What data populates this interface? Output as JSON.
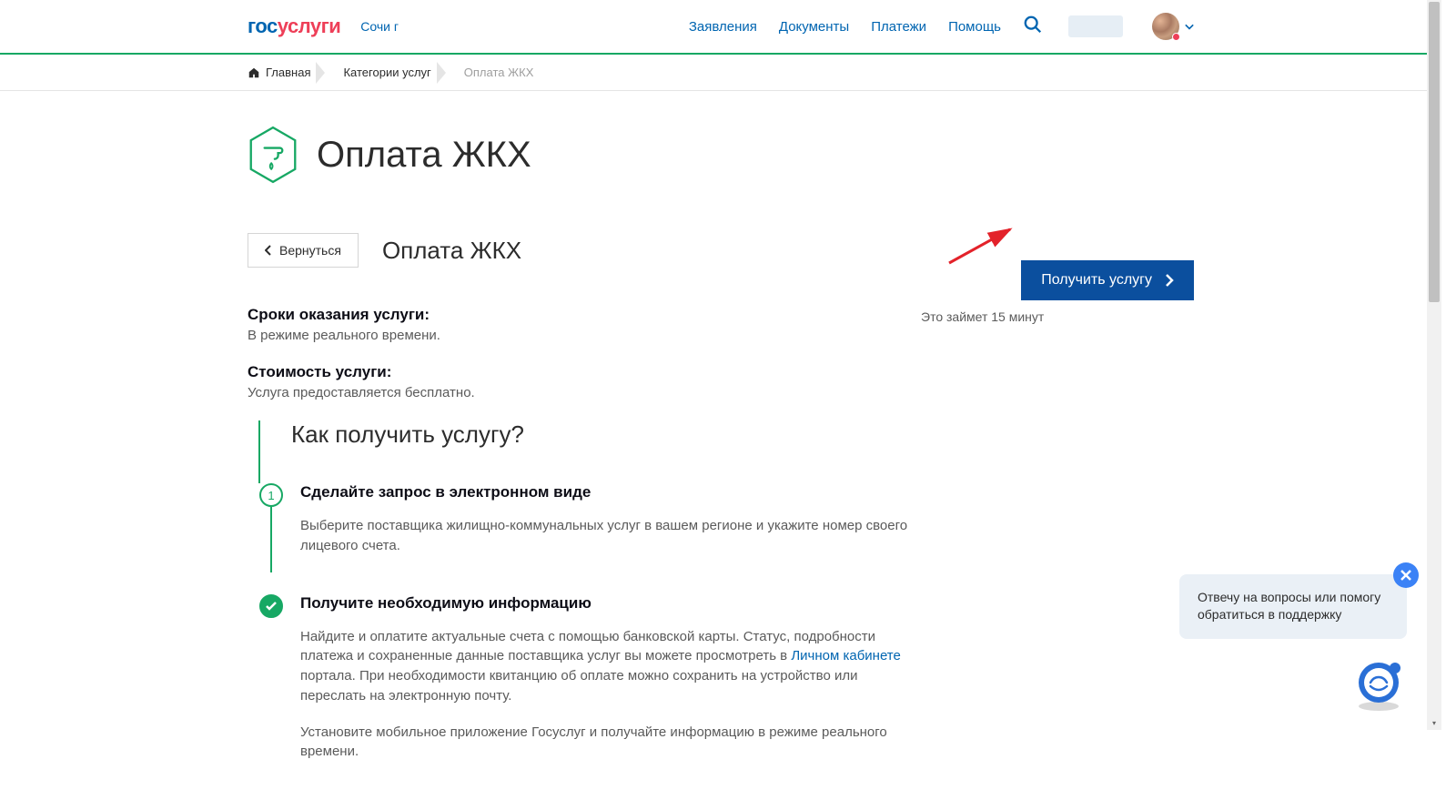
{
  "header": {
    "logo_gos": "гос",
    "logo_uslugi": "услуги",
    "region": "Сочи г",
    "nav": {
      "applications": "Заявления",
      "documents": "Документы",
      "payments": "Платежи",
      "help": "Помощь"
    }
  },
  "breadcrumb": {
    "home": "Главная",
    "categories": "Категории услуг",
    "current": "Оплата ЖКХ"
  },
  "page": {
    "title": "Оплата ЖКХ",
    "back": "Вернуться",
    "subtitle": "Оплата ЖКХ",
    "timing_label": "Сроки оказания услуги:",
    "timing_value": "В режиме реального времени.",
    "cost_label": "Стоимость услуги:",
    "cost_value": "Услуга предоставляется бесплатно.",
    "action_button": "Получить услугу",
    "action_note": "Это займет 15 минут",
    "steps_title": "Как получить услугу?",
    "step1_title": "Сделайте запрос в электронном виде",
    "step1_text": "Выберите поставщика жилищно-коммунальных услуг в вашем регионе и укажите номер своего лицевого счета.",
    "step2_title": "Получите необходимую информацию",
    "step2_text_part1": "Найдите и оплатите актуальные счета с помощью банковской карты. Статус, подробности платежа и сохраненные данные поставщика услуг вы можете просмотреть в ",
    "step2_link": "Личном кабинете",
    "step2_text_part2": " портала. При необходимости квитанцию об оплате можно сохранить на устройство или переслать на электронную почту.",
    "step2_text2": "Установите мобильное приложение Госуслуг и получайте информацию в режиме реального времени."
  },
  "chat": {
    "text": "Отвечу на вопросы или помогу обратиться в поддержку"
  }
}
